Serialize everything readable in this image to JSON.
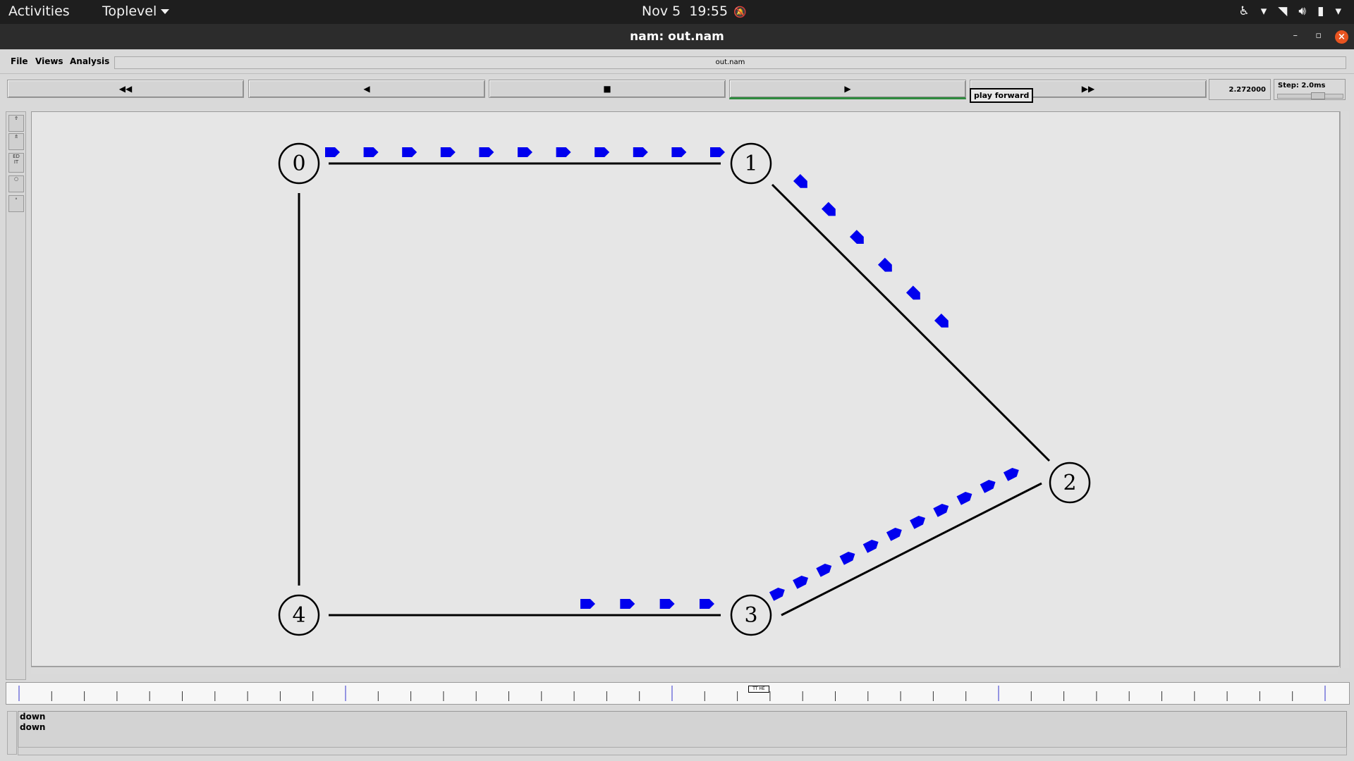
{
  "topbar": {
    "activities": "Activities",
    "app_menu": "Toplevel",
    "date": "Nov 5",
    "time": "19:55"
  },
  "window": {
    "title": "nam: out.nam"
  },
  "menu": {
    "file": "File",
    "views": "Views",
    "analysis": "Analysis",
    "filename": "out.nam"
  },
  "transport": {
    "buttons": [
      {
        "name": "rewind",
        "glyph": "◀◀"
      },
      {
        "name": "play-backward",
        "glyph": "◀"
      },
      {
        "name": "stop",
        "glyph": "■"
      },
      {
        "name": "play-forward",
        "glyph": "▶"
      },
      {
        "name": "fast-forward",
        "glyph": "▶▶"
      }
    ],
    "current_time": "2.272000",
    "step": "Step: 2.0ms",
    "tooltip": "play forward"
  },
  "tools": [
    "zoom-in-icon",
    "zoom-out-icon",
    "edit-icon",
    "circle-icon",
    "small-circle-icon"
  ],
  "network": {
    "nodes": [
      {
        "id": "0"
      },
      {
        "id": "1"
      },
      {
        "id": "2"
      },
      {
        "id": "3"
      },
      {
        "id": "4"
      }
    ],
    "links": [
      [
        "0",
        "1"
      ],
      [
        "1",
        "2"
      ],
      [
        "2",
        "3"
      ],
      [
        "3",
        "4"
      ],
      [
        "4",
        "0"
      ]
    ],
    "packet_color": "#0000ee",
    "packet_counts": {
      "0-1": 11,
      "1-2": 6,
      "3-2": 11,
      "4-3": 4
    }
  },
  "timeline": {
    "marker_label": "TT HE"
  },
  "annotations": [
    "down",
    "down"
  ]
}
